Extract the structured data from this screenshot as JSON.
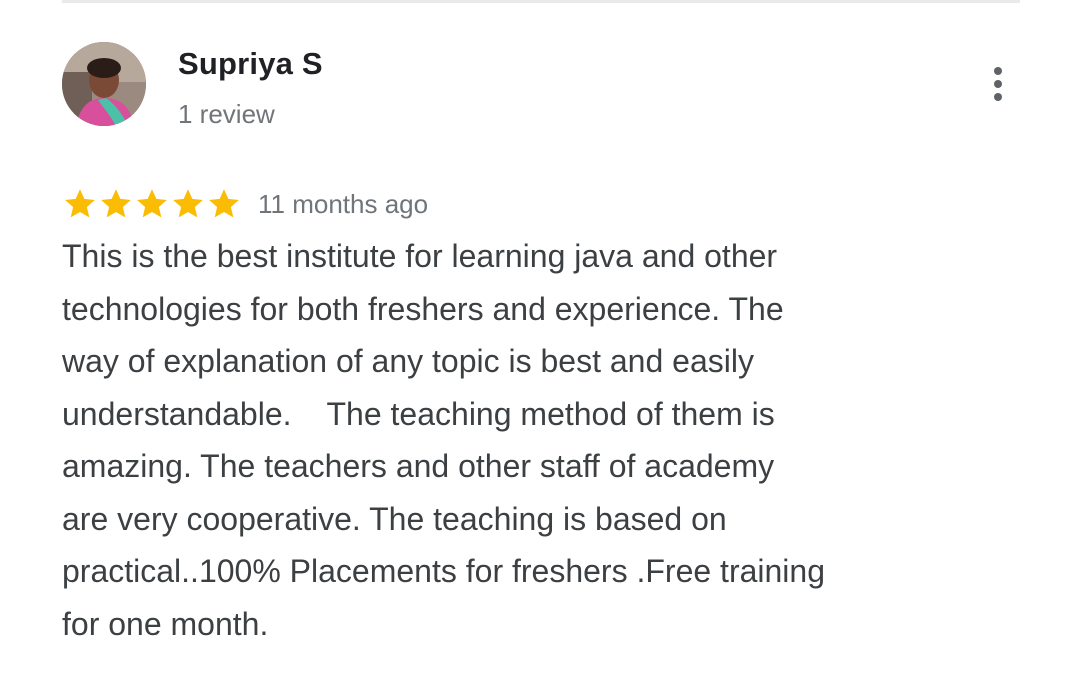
{
  "reviewer": {
    "name": "Supriya S",
    "meta": "1 review",
    "avatar_icon": "profile-photo"
  },
  "menu": {
    "icon": "more-vert-icon"
  },
  "review": {
    "rating": 5,
    "rating_max": 5,
    "star_color": "#fbbc04",
    "date": "11 months ago",
    "text": "This is the best institute for learning java and other\ntechnologies for both freshers and experience. The\nway of explanation of any topic is best and easily\nunderstandable.    The teaching method of them is\namazing. The teachers and other staff of academy\nare very cooperative. The teaching is based on\npractical..100% Placements for freshers .Free training\nfor one month."
  }
}
